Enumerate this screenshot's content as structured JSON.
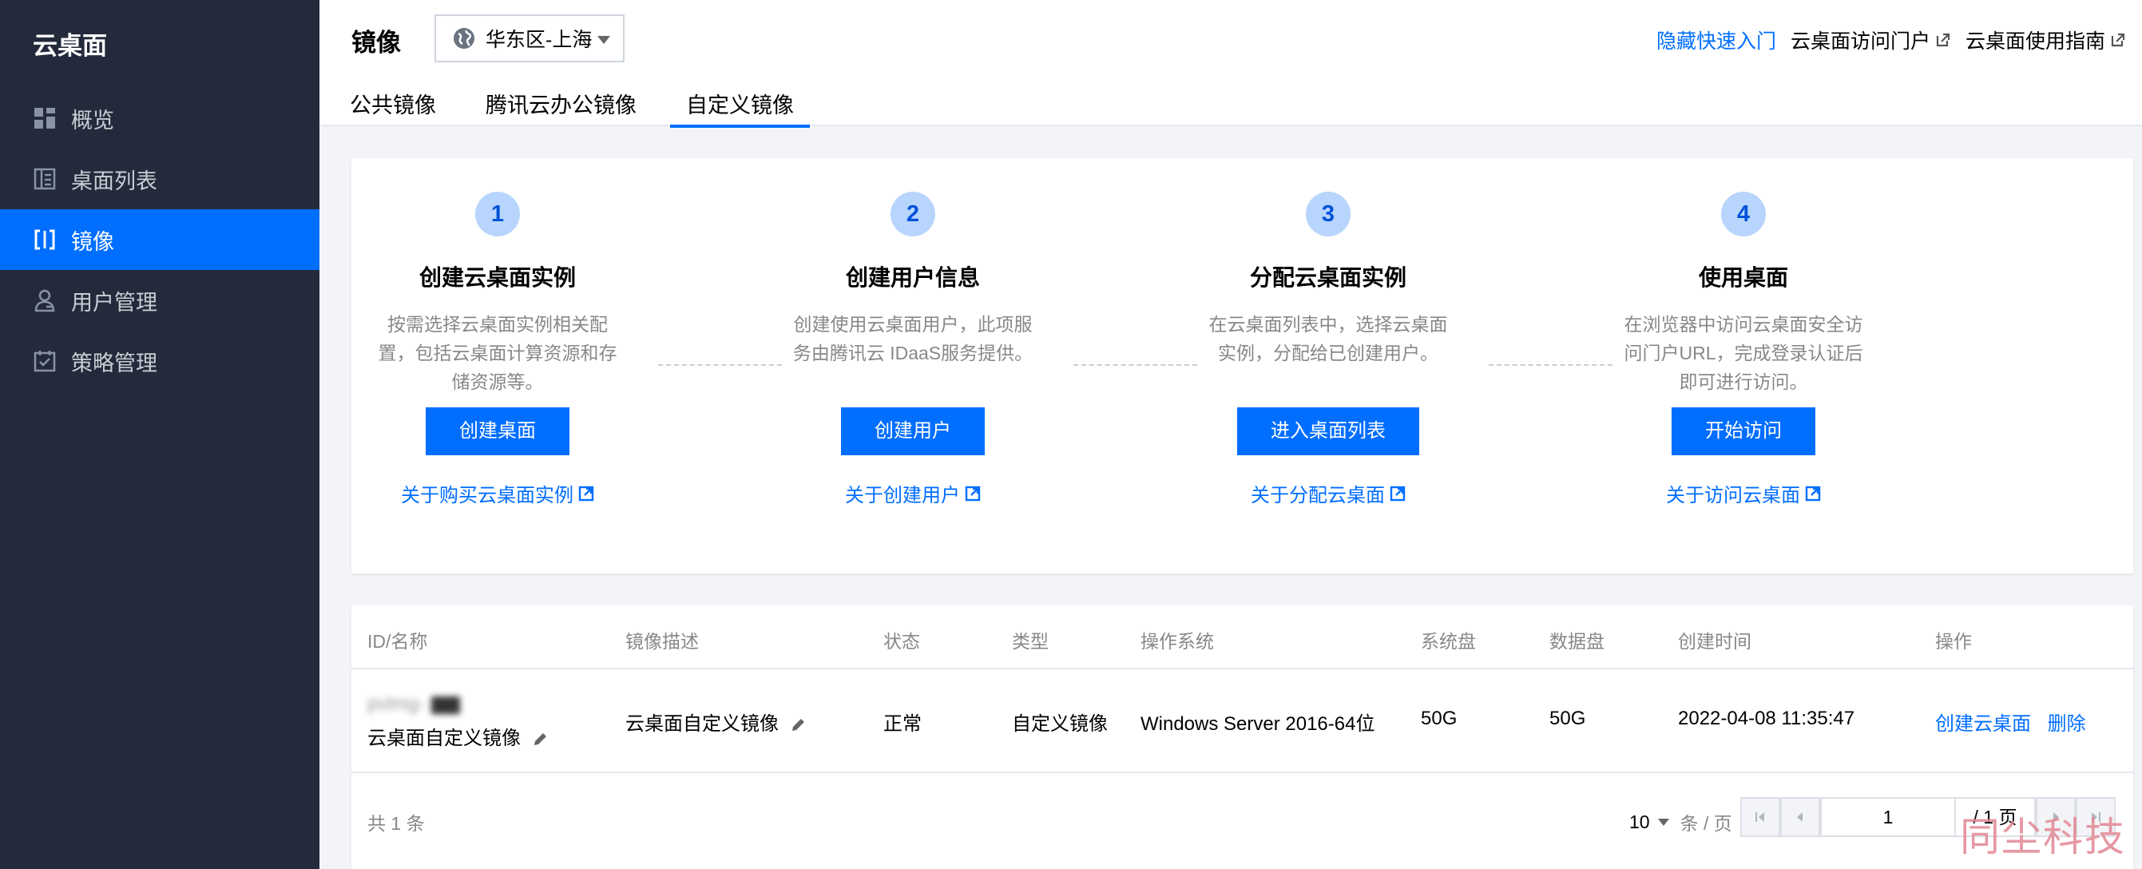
{
  "sidebar": {
    "brand": "云桌面",
    "items": [
      {
        "label": "概览",
        "icon": "dashboard-icon"
      },
      {
        "label": "桌面列表",
        "icon": "list-icon"
      },
      {
        "label": "镜像",
        "icon": "image-icon",
        "active": true
      },
      {
        "label": "用户管理",
        "icon": "user-icon"
      },
      {
        "label": "策略管理",
        "icon": "policy-icon"
      }
    ]
  },
  "header": {
    "title": "镜像",
    "region": "华东区-上海",
    "links": {
      "hide_quickstart": "隐藏快速入门",
      "portal": "云桌面访问门户",
      "guide": "云桌面使用指南"
    },
    "tabs": [
      "公共镜像",
      "腾讯云办公镜像",
      "自定义镜像"
    ],
    "active_tab": "自定义镜像"
  },
  "steps": [
    {
      "num": "1",
      "title": "创建云桌面实例",
      "desc": "按需选择云桌面实例相关配置，包括云桌面计算资源和存储资源等。",
      "button": "创建桌面",
      "link": "关于购买云桌面实例"
    },
    {
      "num": "2",
      "title": "创建用户信息",
      "desc": "创建使用云桌面用户，此项服务由腾讯云 IDaaS服务提供。",
      "button": "创建用户",
      "link": "关于创建用户"
    },
    {
      "num": "3",
      "title": "分配云桌面实例",
      "desc": "在云桌面列表中，选择云桌面实例，分配给已创建用户。",
      "button": "进入桌面列表",
      "link": "关于分配云桌面"
    },
    {
      "num": "4",
      "title": "使用桌面",
      "desc": "在浏览器中访问云桌面安全访问门户URL，完成登录认证后即可进行访问。",
      "button": "开始访问",
      "link": "关于访问云桌面"
    }
  ],
  "table": {
    "columns": [
      "ID/名称",
      "镜像描述",
      "状态",
      "类型",
      "操作系统",
      "系统盘",
      "数据盘",
      "创建时间",
      "操作"
    ],
    "rows": [
      {
        "id": "pvlmg-",
        "name": "云桌面自定义镜像",
        "desc": "云桌面自定义镜像",
        "status": "正常",
        "type": "自定义镜像",
        "os": "Windows Server 2016-64位",
        "sys_disk": "50G",
        "data_disk": "50G",
        "created": "2022-04-08 11:35:47",
        "actions": [
          "创建云桌面",
          "删除"
        ]
      }
    ]
  },
  "pagination": {
    "total_text": "共 1 条",
    "page_size": "10",
    "page_size_unit": "条 / 页",
    "current_page": "1",
    "total_pages": "/ 1 页"
  },
  "watermark": "同尘科技",
  "colors": {
    "sidebar_bg": "#232a3b",
    "accent": "#006eff",
    "step_circle": "#b8d5fd"
  }
}
